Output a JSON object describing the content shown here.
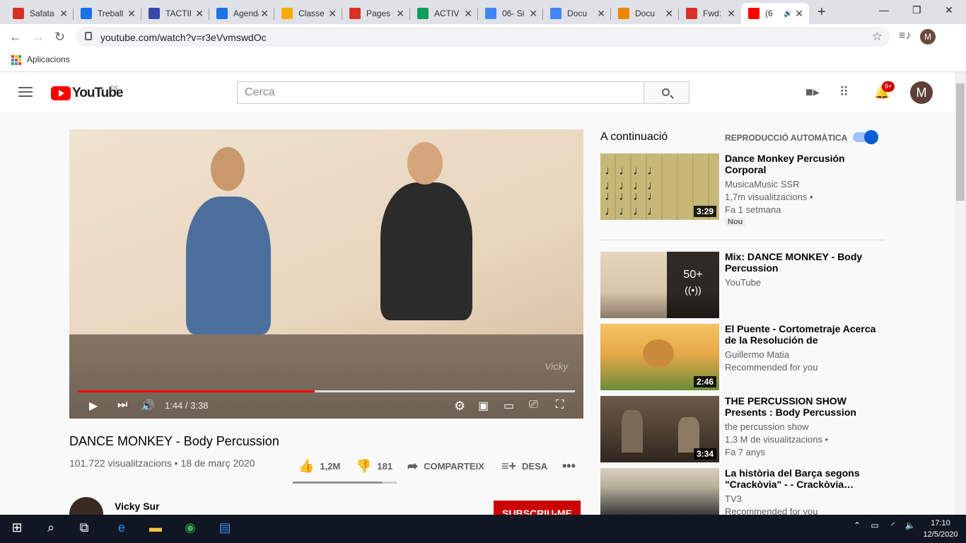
{
  "browser": {
    "tabs": [
      {
        "title": "Safata",
        "color": "#d93025"
      },
      {
        "title": "Treball",
        "color": "#1a73e8"
      },
      {
        "title": "TACTIL",
        "color": "#3949ab"
      },
      {
        "title": "Agenda",
        "color": "#1a73e8"
      },
      {
        "title": "Classe",
        "color": "#f9ab00"
      },
      {
        "title": "Pages",
        "color": "#d93025"
      },
      {
        "title": "ACTIV",
        "color": "#0f9d58"
      },
      {
        "title": "06- Si",
        "color": "#4285f4"
      },
      {
        "title": "Docu",
        "color": "#4285f4"
      },
      {
        "title": "Docu",
        "color": "#ea8600"
      },
      {
        "title": "Fwd:",
        "color": "#d93025"
      },
      {
        "title": "(6",
        "color": "#ff0000"
      }
    ],
    "url": "youtube.com/watch?v=r3eVvmswdOc",
    "bookmarks_label": "Aplicacions",
    "profile_initial": "M"
  },
  "youtube": {
    "logo_text": "YouTube",
    "country": "ES",
    "search_placeholder": "Cerca",
    "notifications": "9+",
    "avatar_initial": "M"
  },
  "player": {
    "time": "1:44 / 3:38",
    "progress_fraction": 0.477,
    "watermark": "Vicky"
  },
  "video": {
    "title": "DANCE MONKEY - Body Percussion",
    "views_date": "101.722 visualitzacions • 18 de març 2020",
    "likes": "1,2M",
    "dislikes": "181",
    "share": "COMPARTEIX",
    "save": "DESA",
    "like_ratio": 0.86
  },
  "channel": {
    "name": "Vicky Sur",
    "subscribe": "SUBSCRIU-ME"
  },
  "sidebar": {
    "up_next": "A continuació",
    "autoplay": "REPRODUCCIÓ AUTOMÀTICA",
    "items": [
      {
        "title": "Dance Monkey Percusión Corporal",
        "channel": "MusicaMusic SSR",
        "meta1": "1,7m visualitzacions •",
        "meta2": "Fa 1 setmana",
        "badge": "Nou",
        "duration": "3:29"
      },
      {
        "title": "Mix: DANCE MONKEY - Body Percussion",
        "channel": "YouTube",
        "mix_count": "50+",
        "mix_icon": "((•))"
      },
      {
        "title": "El Puente - Cortometraje Acerca de la Resolución de Conflictos…",
        "channel": "Guillermo Matia",
        "meta1": "Recommended for you",
        "duration": "2:46"
      },
      {
        "title": "THE PERCUSSION SHOW Presents : Body Percussion",
        "channel": "the percussion show",
        "meta1": "1,3 M de visualitzacions •",
        "meta2": "Fa 7 anys",
        "duration": "3:34"
      },
      {
        "title": "La història del Barça segons \"Crackòvia\" - - Crackòvia…",
        "channel": "TV3",
        "meta1": "Recommended for you"
      }
    ]
  },
  "taskbar": {
    "time": "17:10",
    "date": "12/5/2020"
  }
}
